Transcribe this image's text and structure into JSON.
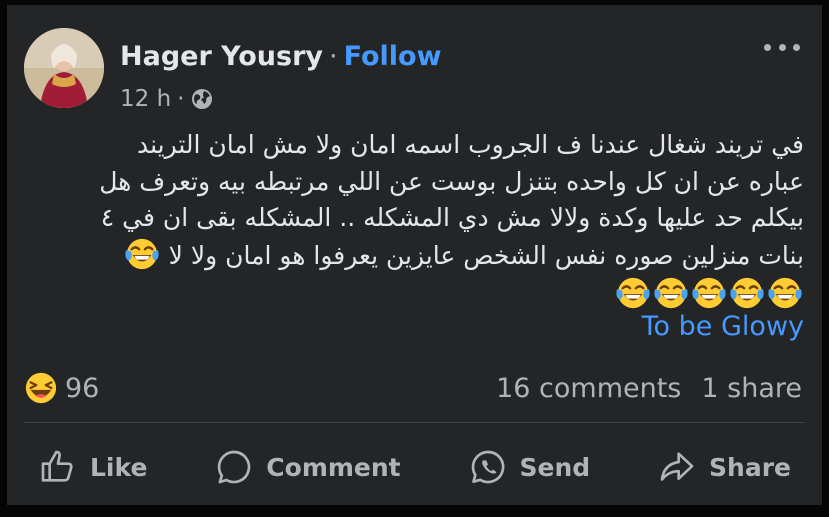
{
  "post": {
    "author": "Hager Yousry",
    "separator": "·",
    "follow_label": "Follow",
    "time": "12 h",
    "meta_dot": "·",
    "audience_icon": "globe-icon",
    "more_icon": "more-options-icon",
    "body_lines": [
      "في تريند شغال عندنا ف الجروب اسمه امان ولا مش امان التريند",
      "عباره عن ان كل واحده بتنزل بوست عن اللي مرتبطه بيه وتعرف هل",
      "بيكلم حد عليها وكدة ولالا مش دي المشكله .. المشكله بقى ان في ٤",
      "بنات منزلين صوره نفس الشخص عايزين يعرفوا هو امان ولا لا"
    ],
    "emoji_name": "tears-of-joy-emoji",
    "link_text": "To be Glowy"
  },
  "stats": {
    "reaction_icon": "haha-reaction-icon",
    "reaction_count": "96",
    "comments": "16 comments",
    "shares": "1 share"
  },
  "actions": {
    "like": "Like",
    "comment": "Comment",
    "send": "Send",
    "share": "Share"
  },
  "colors": {
    "background": "#242526",
    "text": "#e4e6eb",
    "muted": "#b0b3b8",
    "link": "#4599ff"
  }
}
